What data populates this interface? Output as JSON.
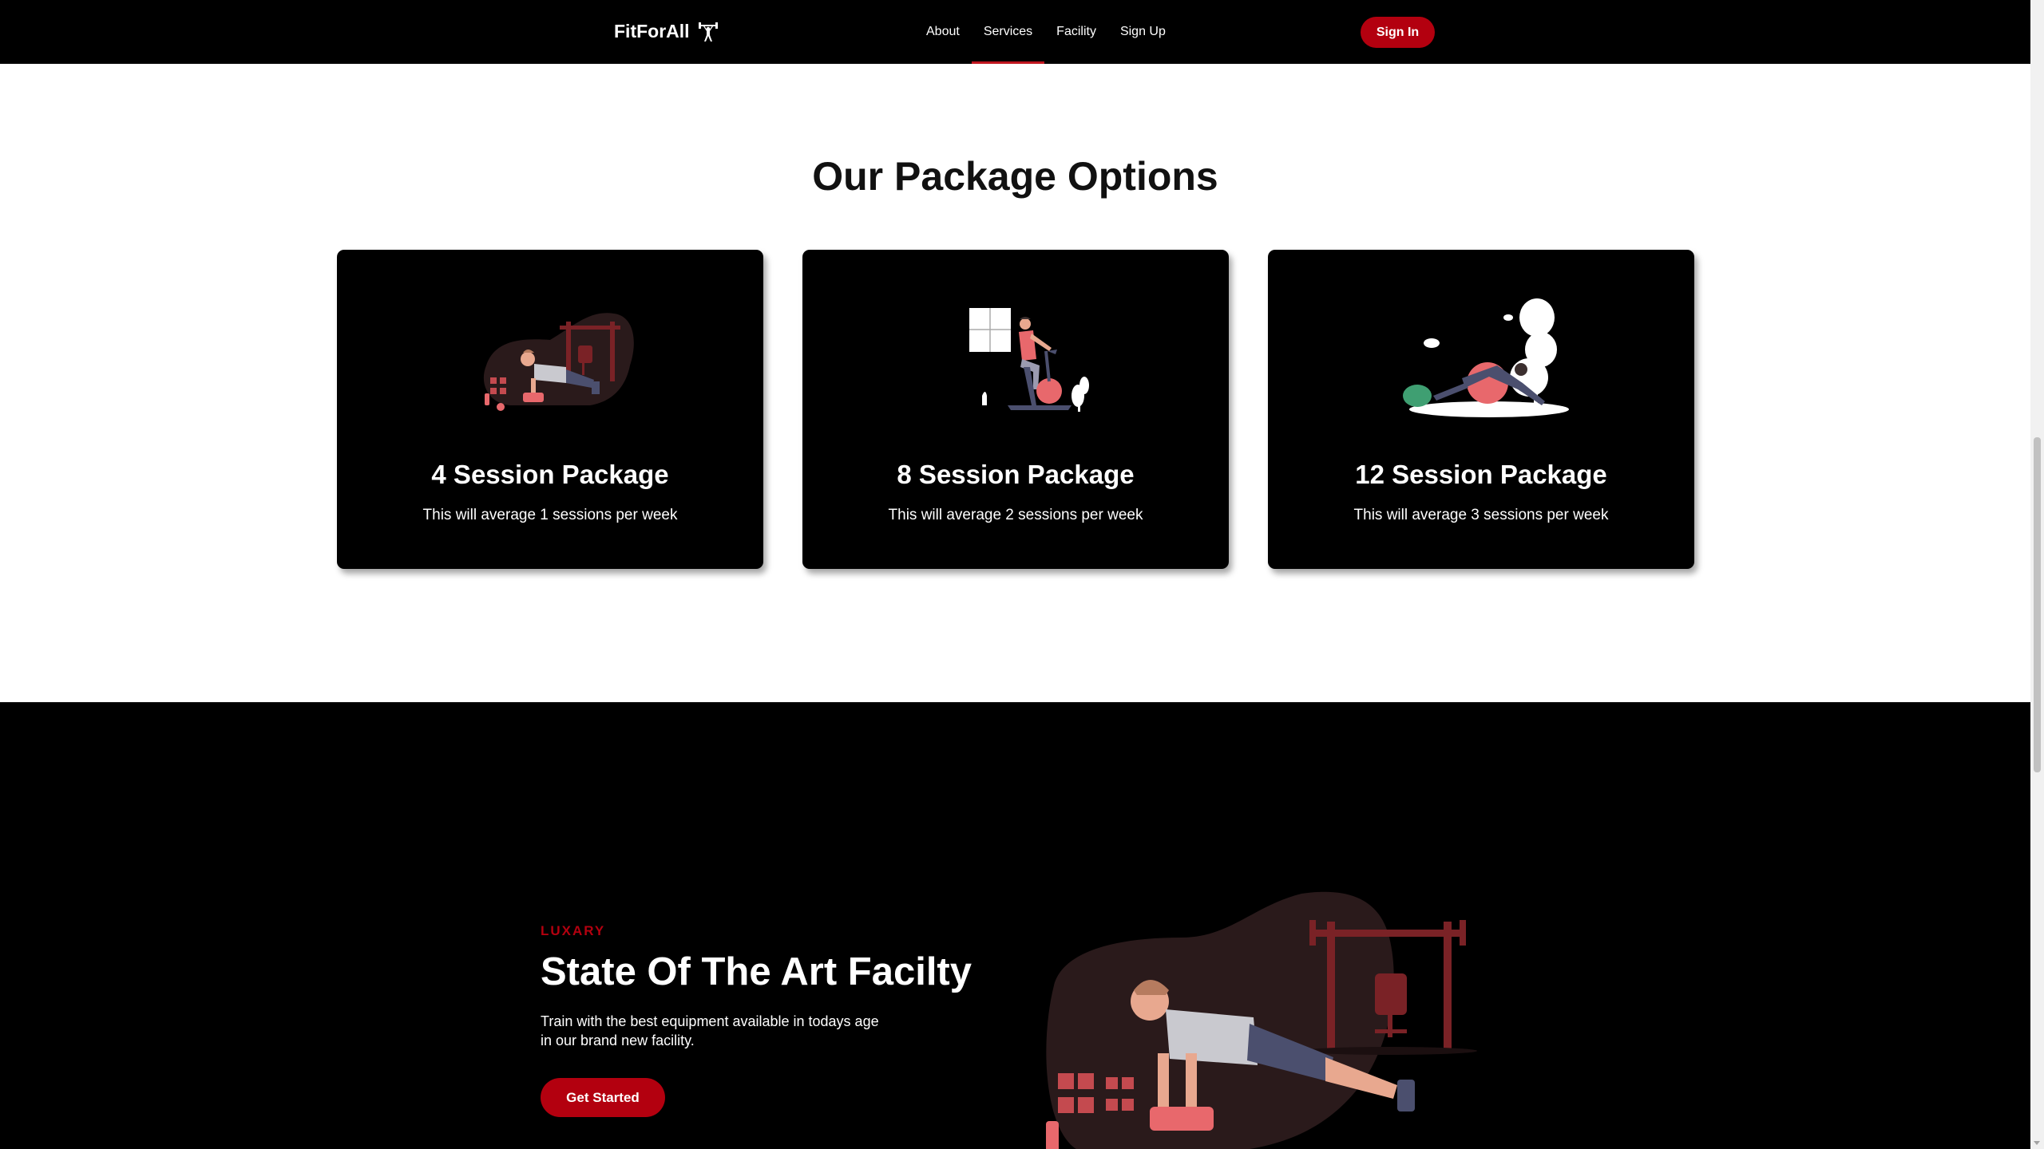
{
  "nav": {
    "brand": "FitForAll",
    "links": [
      "About",
      "Services",
      "Facility",
      "Sign Up"
    ],
    "active": "Services",
    "signin": "Sign In"
  },
  "packages": {
    "title": "Our Package Options",
    "cards": [
      {
        "title": "4 Session Package",
        "desc": "This will average 1 sessions per week",
        "illustration": "pushup-gym-illustration"
      },
      {
        "title": "8 Session Package",
        "desc": "This will average 2 sessions per week",
        "illustration": "stationary-bike-illustration"
      },
      {
        "title": "12 Session Package",
        "desc": "This will average 3 sessions per week",
        "illustration": "yoga-ball-illustration"
      }
    ]
  },
  "facility": {
    "eyebrow": "LUXARY",
    "title": "State Of The Art Facilty",
    "desc": "Train with the best equipment available in todays age in our brand new facility.",
    "cta": "Get Started"
  },
  "colors": {
    "accent": "#b3000f",
    "nav_bg": "#000000",
    "illustration_red": "#e8686c",
    "illustration_dark": "#7a2226"
  }
}
